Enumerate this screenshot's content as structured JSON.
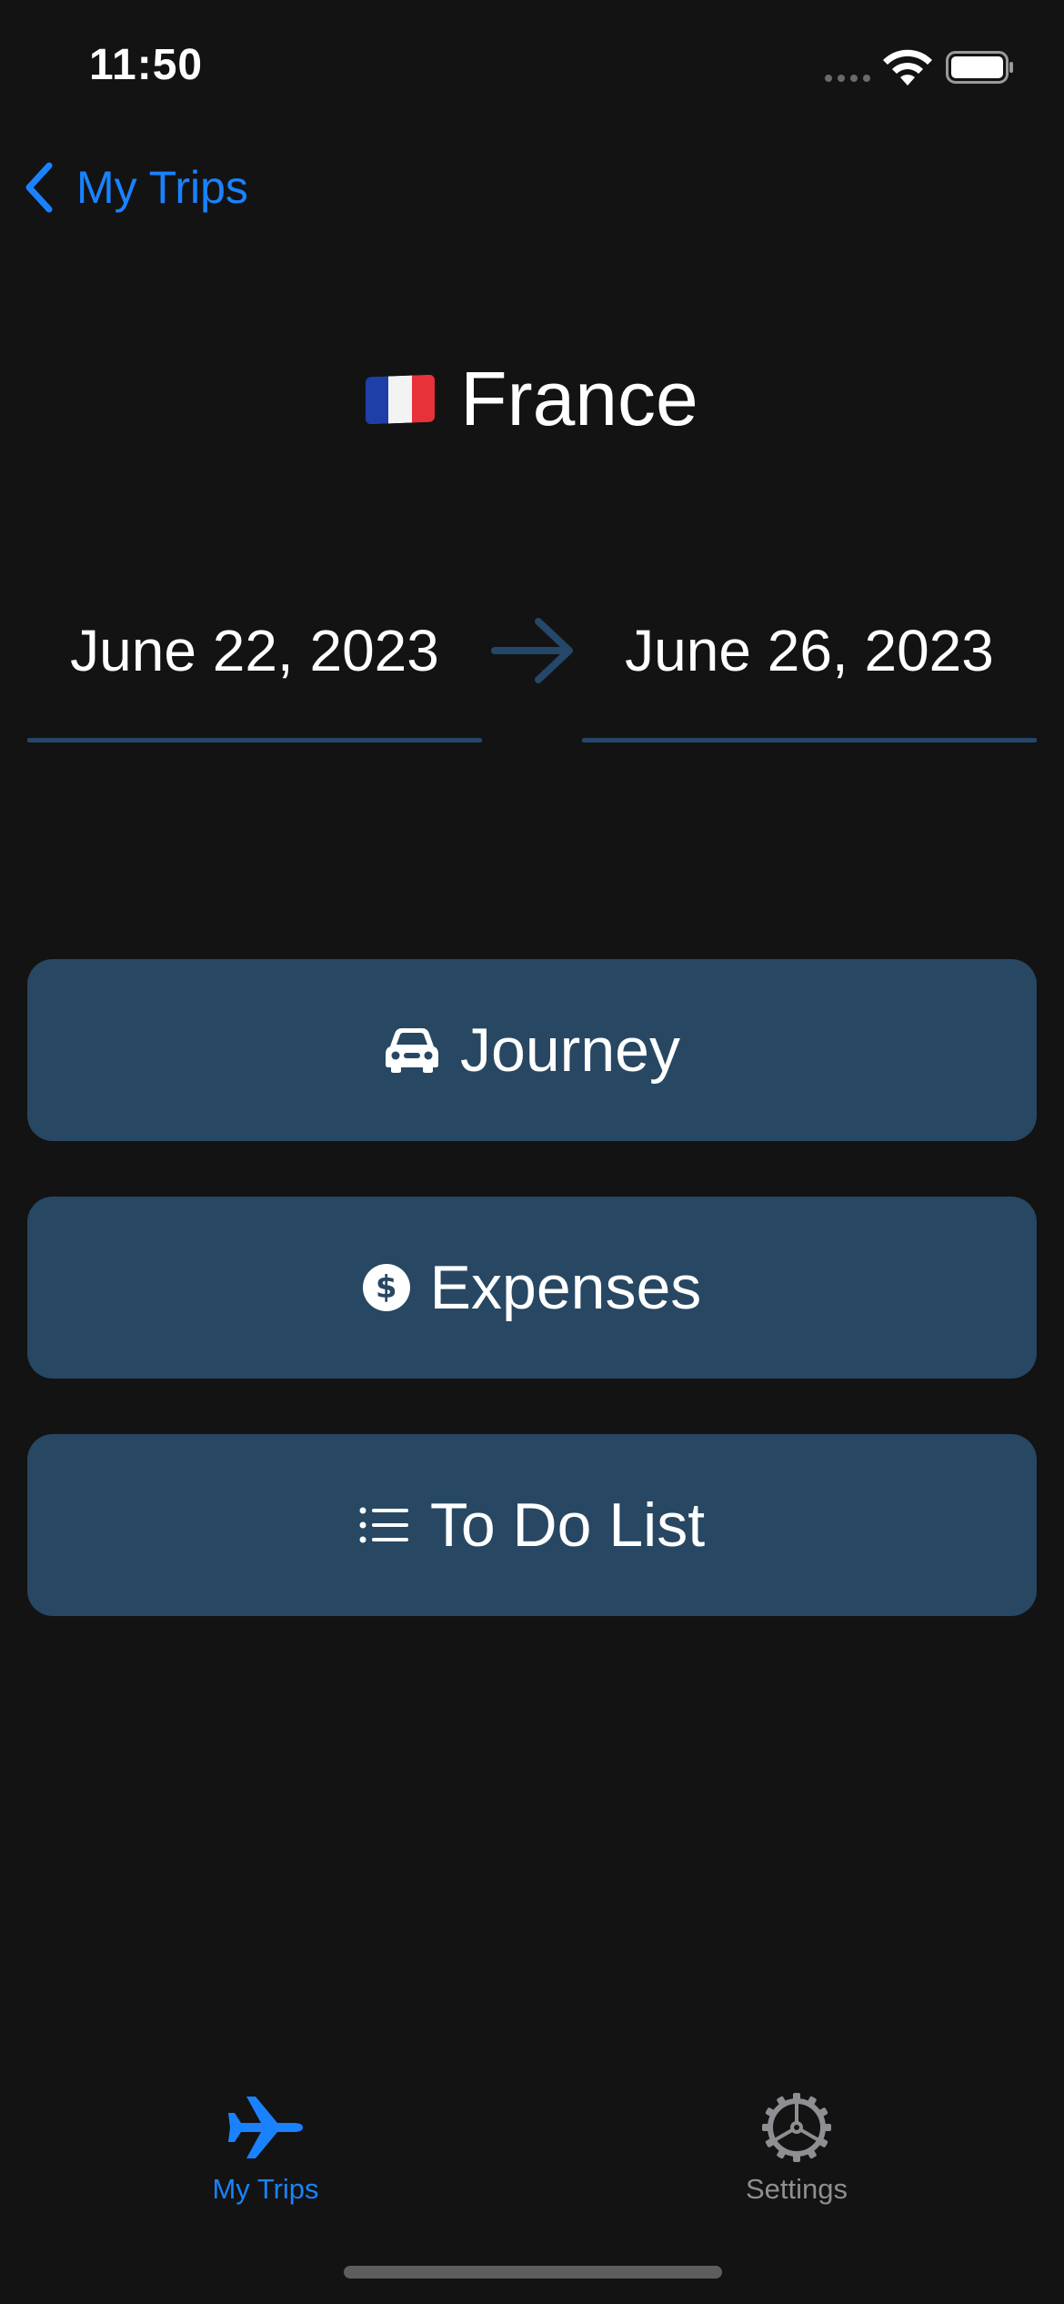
{
  "status_bar": {
    "time": "11:50"
  },
  "nav": {
    "back_label": "My Trips"
  },
  "trip": {
    "country": "France",
    "flag_icon": "france-flag",
    "start_date": "June 22, 2023",
    "end_date": "June 26, 2023"
  },
  "actions": [
    {
      "label": "Journey",
      "icon": "car-icon"
    },
    {
      "label": "Expenses",
      "icon": "dollar-circle-icon",
      "icon_glyph": "$"
    },
    {
      "label": "To Do List",
      "icon": "list-icon"
    }
  ],
  "tab_bar": {
    "tabs": [
      {
        "label": "My Trips",
        "icon": "airplane-icon",
        "active": true
      },
      {
        "label": "Settings",
        "icon": "gear-icon",
        "active": false
      }
    ]
  },
  "colors": {
    "background": "#131313",
    "accent": "#1a82ff",
    "button": "#274763",
    "underline": "#25476a",
    "inactive": "#8e8e93"
  }
}
